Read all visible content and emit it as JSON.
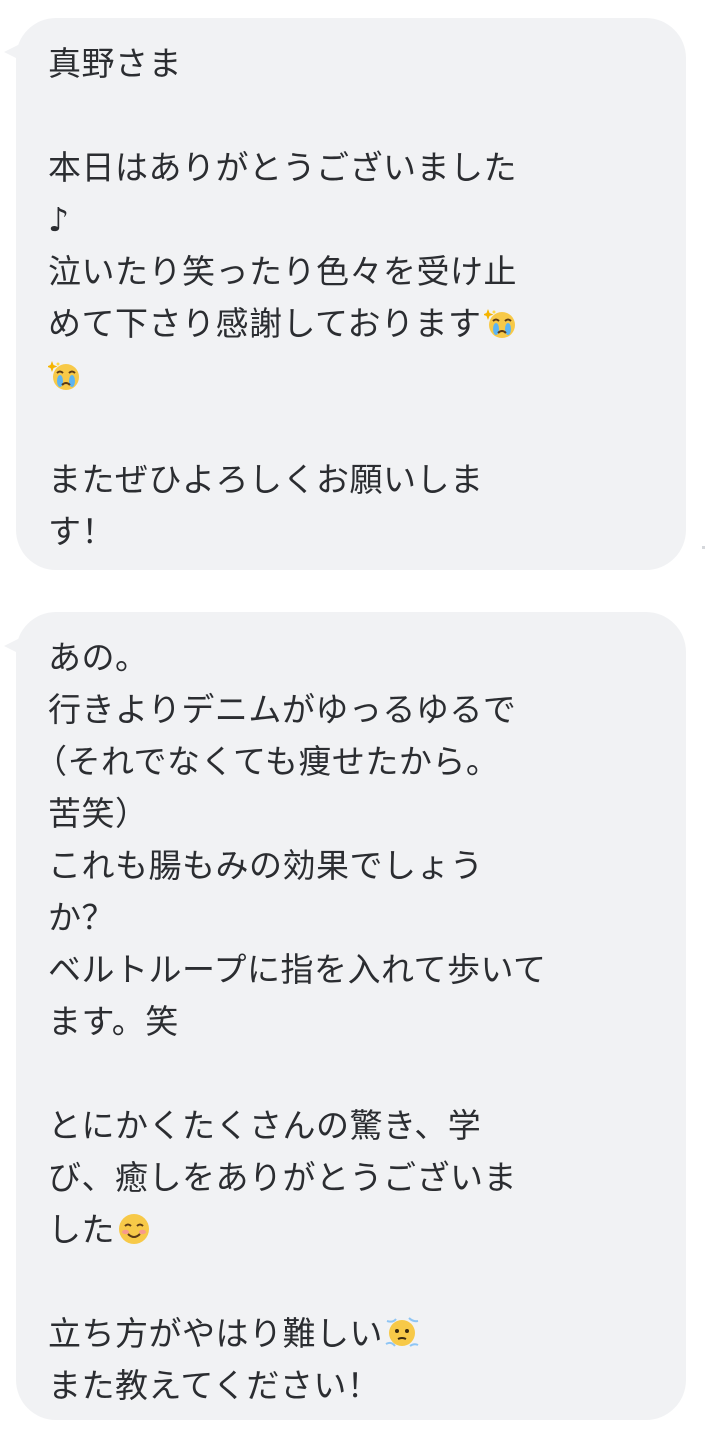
{
  "messages": [
    {
      "lines": [
        "真野さま",
        "",
        "本日はありがとうございました",
        "♪",
        "泣いたり笑ったり色々を受け止",
        "めて下さり感謝しております",
        "",
        "",
        "またぜひよろしくお願いしま",
        "す！"
      ]
    },
    {
      "lines": [
        "あの。",
        "行きよりデニムがゆっるゆるで",
        "（それでなくても痩せたから。",
        "苦笑）",
        "これも腸もみの効果でしょう",
        "か？",
        "ベルトループに指を入れて歩いて",
        "ます。笑",
        "",
        "とにかくたくさんの驚き、学",
        "び、癒しをありがとうございま",
        "した",
        "",
        "立ち方がやはり難しい",
        "また教えてください！"
      ]
    }
  ],
  "icons": {
    "crying_sparkle_emoji": "crying-face-sparkle-icon",
    "smile_emoji": "smiling-face-icon",
    "sweat_emoji": "cold-sweat-face-icon"
  },
  "colors": {
    "bubble_background": "#f1f2f4",
    "text": "#2b2d31",
    "page_background": "#ffffff"
  }
}
